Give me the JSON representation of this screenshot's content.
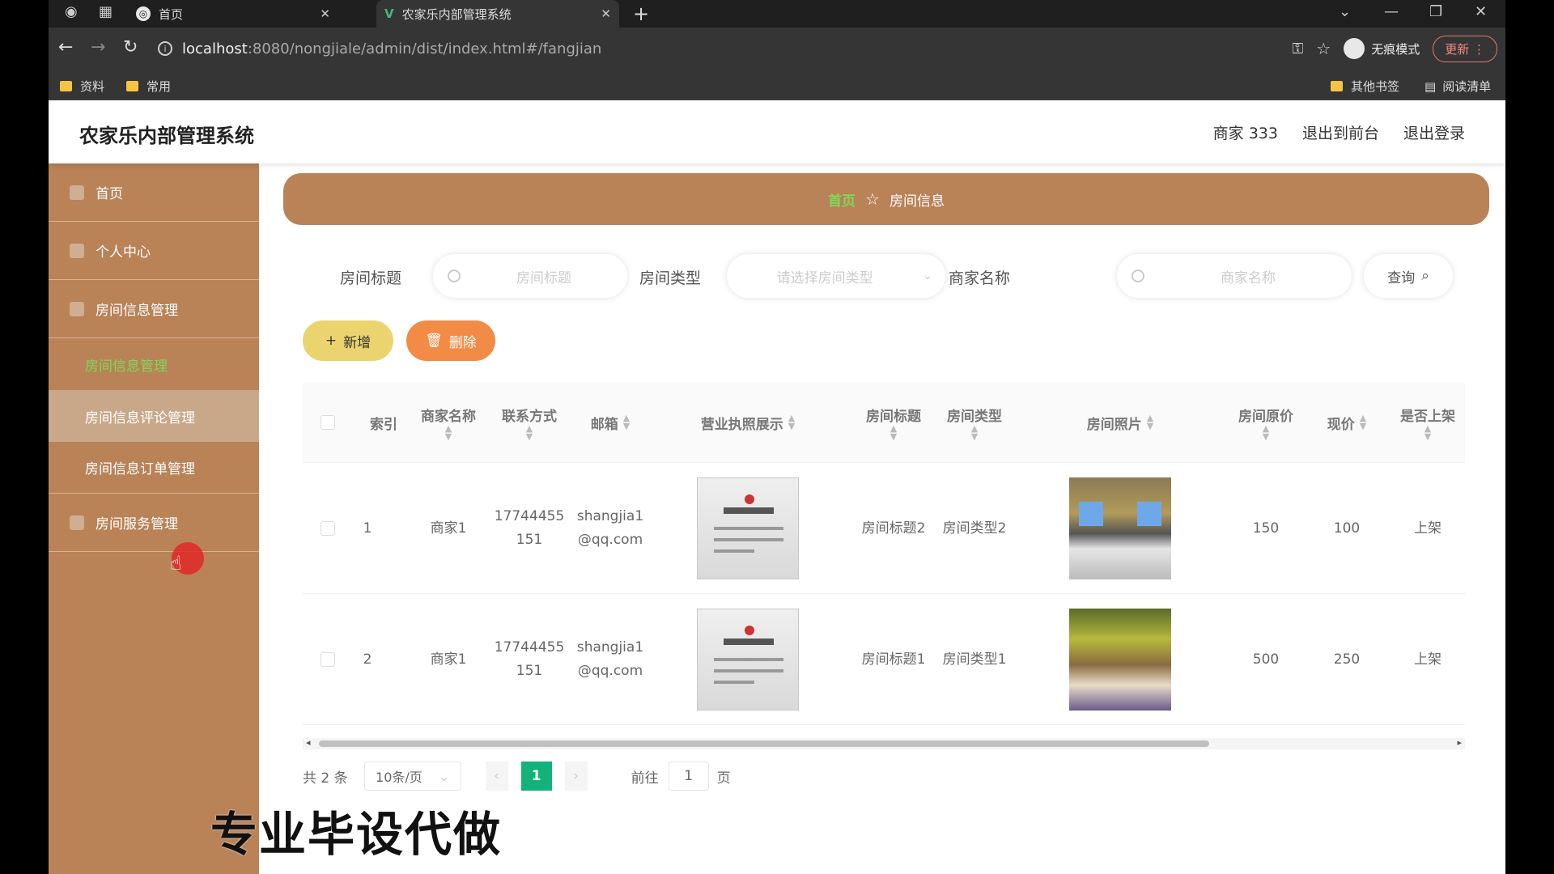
{
  "browser": {
    "tabs": [
      {
        "title": "首页"
      },
      {
        "title": "农家乐内部管理系统"
      }
    ],
    "url_host": "localhost",
    "url_path": ":8080/nongjiale/admin/dist/index.html#/fangjian",
    "incognito_label": "无痕模式",
    "update_label": "更新",
    "bookmarks": [
      "资料",
      "常用"
    ],
    "bookmarks_right": [
      "其他书签",
      "阅读清单"
    ]
  },
  "header": {
    "title": "农家乐内部管理系统",
    "links": [
      "商家 333",
      "退出到前台",
      "退出登录"
    ]
  },
  "sidebar": {
    "items": [
      {
        "label": "首页"
      },
      {
        "label": "个人中心"
      },
      {
        "label": "房间信息管理"
      }
    ],
    "submenu": [
      "房间信息管理",
      "房间信息评论管理",
      "房间信息订单管理"
    ],
    "last_item": "房间服务管理"
  },
  "breadcrumb": {
    "home": "首页",
    "current": "房间信息"
  },
  "filters": {
    "title_label": "房间标题",
    "title_placeholder": "房间标题",
    "type_label": "房间类型",
    "type_placeholder": "请选择房间类型",
    "merchant_label": "商家名称",
    "merchant_placeholder": "商家名称",
    "query_label": "查询"
  },
  "actions": {
    "add_label": "新增",
    "delete_label": "删除"
  },
  "table": {
    "headers": [
      "索引",
      "商家名称",
      "联系方式",
      "邮箱",
      "营业执照展示",
      "房间标题",
      "房间类型",
      "房间照片",
      "房间原价",
      "现价",
      "是否上架"
    ],
    "rows": [
      {
        "index": "1",
        "merchant": "商家1",
        "phone": "17744455151",
        "email": "shangjia1@qq.com",
        "title": "房间标题2",
        "type": "房间类型2",
        "orig": "150",
        "price": "100",
        "status": "上架"
      },
      {
        "index": "2",
        "merchant": "商家1",
        "phone": "17744455151",
        "email": "shangjia1@qq.com",
        "title": "房间标题1",
        "type": "房间类型1",
        "orig": "500",
        "price": "250",
        "status": "上架"
      }
    ]
  },
  "pager": {
    "total": "共 2 条",
    "size": "10条/页",
    "current": "1",
    "goto": "前往",
    "goto_value": "1",
    "unit": "页"
  },
  "overlay": {
    "watermark": "专业毕设代做"
  },
  "colors": {
    "sidebar": "#b98257",
    "accent_green": "#12b27a",
    "add_btn": "#ebd46e",
    "del_btn": "#f28b46"
  }
}
